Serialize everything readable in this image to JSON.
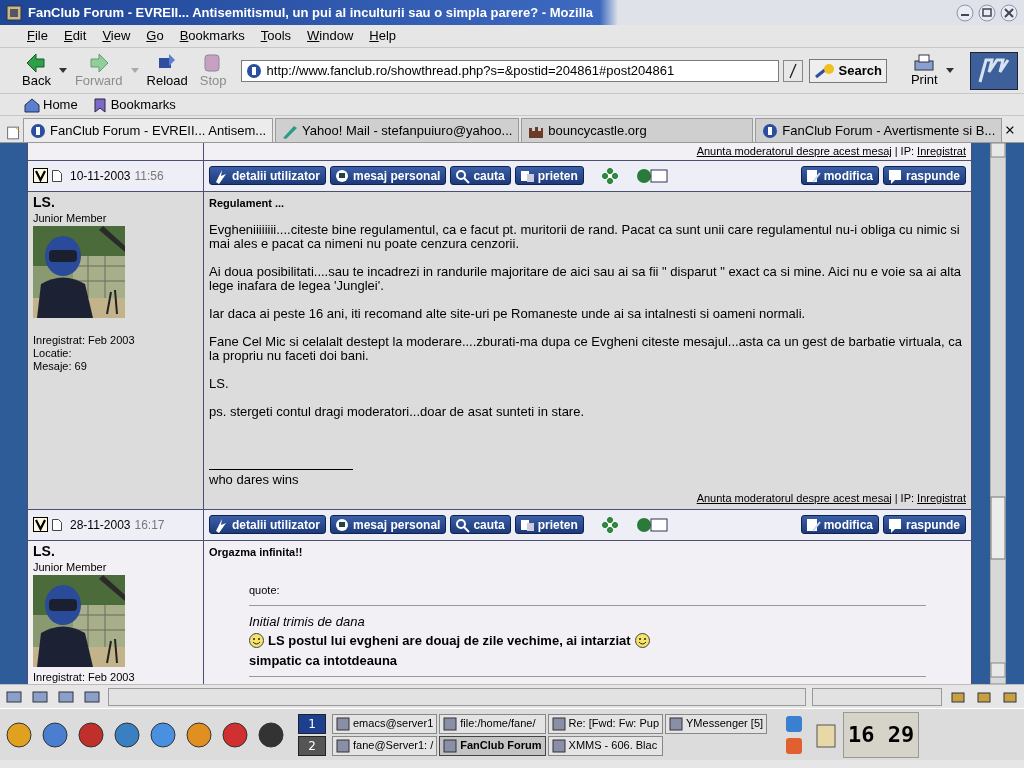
{
  "window": {
    "title": "FanClub Forum - EVREII... Antisemitismul, un pui al inculturii sau o simpla parere? - Mozilla"
  },
  "menu": [
    "File",
    "Edit",
    "View",
    "Go",
    "Bookmarks",
    "Tools",
    "Window",
    "Help"
  ],
  "nav_buttons": [
    {
      "label": "Back",
      "disabled": false,
      "kind": "back"
    },
    {
      "label": "Forward",
      "disabled": true,
      "kind": "forward"
    },
    {
      "label": "Reload",
      "disabled": false,
      "kind": "reload"
    },
    {
      "label": "Stop",
      "disabled": true,
      "kind": "stop"
    }
  ],
  "address": {
    "value": "http://www.fanclub.ro/showthread.php?s=&postid=204861#post204861"
  },
  "search_button": "Search",
  "print_button": "Print",
  "personal_bar": [
    {
      "label": "Home",
      "kind": "home"
    },
    {
      "label": "Bookmarks",
      "kind": "bookmarks"
    }
  ],
  "tabs": [
    {
      "label": "FanClub Forum - EVREII... Antisem...",
      "selected": true,
      "kind": "forum"
    },
    {
      "label": "Yahoo! Mail - stefanpuiuro@yahoo...",
      "selected": false,
      "kind": "mail"
    },
    {
      "label": "bouncycastle.org",
      "selected": false,
      "kind": "castle"
    },
    {
      "label": "FanClub Forum - Avertismente si B...",
      "selected": false,
      "kind": "forum"
    }
  ],
  "prev_footer": {
    "report": "Anunta moderatorul despre acest mesaj",
    "ip_label": "| IP:",
    "ip": "Inregistrat"
  },
  "posts": [
    {
      "date": "10-11-2003",
      "time": "11:56",
      "kind": "alt1",
      "buttons_left": [
        {
          "label": "detalii utilizator",
          "kind": "user"
        },
        {
          "label": "mesaj personal",
          "kind": "pm"
        },
        {
          "label": "cauta",
          "kind": "search"
        },
        {
          "label": "prieten",
          "kind": "friend"
        }
      ],
      "buttons_right": [
        {
          "label": "modifica",
          "kind": "edit"
        },
        {
          "label": "raspunde",
          "kind": "reply"
        }
      ],
      "author": "LS.",
      "rank": "Junior Member",
      "info": [
        "Inregistrat: Feb 2003",
        "Locatie:",
        "Mesaje: 69"
      ],
      "title": "Regulament ...",
      "paragraphs": [
        "Evgheniiiiiiii....citeste bine regulamentul, ca e facut pt. muritorii de rand. Pacat ca sunt unii care regulamentul nu-i obliga cu nimic si mai ales e pacat ca nimeni nu poate cenzura cenzorii.",
        "Ai doua posibilitati....sau te incadrezi in randurile majoritare de aici sau ai sa fii \" disparut \" exact ca si mine. Aici nu e voie sa ai alta lege inafara de legea 'Junglei'.",
        "Iar daca ai peste 16 ani, iti recomand alte site-uri pe Romaneste unde ai sa intalnesti si oameni normali.",
        "Fane Cel Mic si celalalt destept la moderare....zburati-ma dupa ce Evgheni citeste mesajul...asta ca un gest de barbatie virtuala, ca la propriu nu faceti doi bani.",
        "LS.",
        "ps. stergeti contul dragi moderatori...doar de asat sunteti in stare."
      ],
      "signature": "who dares wins",
      "footer": {
        "report": "Anunta moderatorul despre acest mesaj",
        "ip_label": "| IP:",
        "ip": "Inregistrat"
      }
    },
    {
      "date": "28-11-2003",
      "time": "16:17",
      "kind": "alt2",
      "buttons_left": [
        {
          "label": "detalii utilizator",
          "kind": "user"
        },
        {
          "label": "mesaj personal",
          "kind": "pm"
        },
        {
          "label": "cauta",
          "kind": "search"
        },
        {
          "label": "prieten",
          "kind": "friend"
        }
      ],
      "buttons_right": [
        {
          "label": "modifica",
          "kind": "edit"
        },
        {
          "label": "raspunde",
          "kind": "reply"
        }
      ],
      "author": "LS.",
      "rank": "Junior Member",
      "info": [
        "Inregistrat: Feb 2003"
      ],
      "title": "Orgazma infinita!!",
      "quote": {
        "label": "quote:",
        "author": "Initial trimis de dana",
        "lines": [
          {
            "text": "LS postul lui evgheni are douaj de zile vechime, ai intarziat",
            "smiley_before": true,
            "smiley_after": true
          },
          {
            "text": "simpatic ca intotdeauna",
            "smiley_before": false,
            "smiley_after": false
          }
        ]
      }
    }
  ],
  "taskbar": {
    "pager": [
      {
        "label": "1",
        "selected": true
      },
      {
        "label": "2",
        "selected": false
      }
    ],
    "tasks": [
      {
        "label": "emacs@server1",
        "selected": false
      },
      {
        "label": "file:/home/fane/",
        "selected": false
      },
      {
        "label": "Re: [Fwd: Fw: Pup",
        "selected": false
      },
      {
        "label": "YMessenger [5]",
        "selected": false
      },
      {
        "label": "fane@Server1: /",
        "selected": false
      },
      {
        "label": "FanClub Forum",
        "selected": true
      },
      {
        "label": "XMMS - 606. Blac",
        "selected": false
      }
    ],
    "clock": "16 29"
  }
}
